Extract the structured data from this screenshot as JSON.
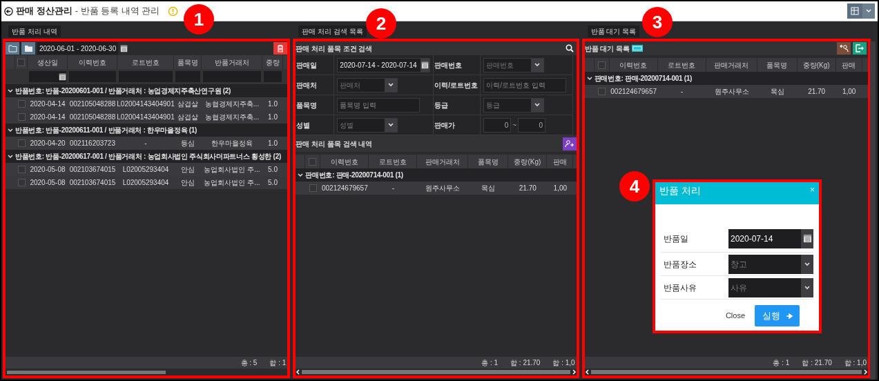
{
  "header": {
    "title": "판매 정산관리",
    "subtitle": "- 반품 등록 내역 관리"
  },
  "returns_panel": {
    "tab": "반품 처리 내역",
    "all_checked": false,
    "date_range": "2020-06-01 - 2020-06-30",
    "columns": [
      "생산일",
      "이력번호",
      "로트번호",
      "품목명",
      "반품거래처",
      "중량"
    ],
    "groups": [
      {
        "label": "반품번호: 반품-20200601-001 / 반품거래처 : 농업경제지주축산연구원 (2)",
        "expanded": true,
        "rows": [
          {
            "checked": false,
            "cells": [
              "2020-04-14",
              "002105048288",
              "L02004143404901",
              "삼겹살",
              "농협경제지주축...",
              "1.0"
            ]
          },
          {
            "checked": false,
            "cells": [
              "2020-04-14",
              "002105048288",
              "L02004143404901",
              "삼겹살",
              "농협경제지주축...",
              "1.0"
            ]
          }
        ]
      },
      {
        "label": "반품번호: 반품-20200611-001 / 반품거래처 : 한우마을정육 (1)",
        "expanded": true,
        "rows": [
          {
            "checked": false,
            "cells": [
              "2020-04-20",
              "002116203723",
              "-",
              "등심",
              "한우마을정육",
              "1.0"
            ]
          }
        ]
      },
      {
        "label": "반품번호: 반품-20200617-001 / 반품거래처 : 농업회사법인 주식회사더파트너스 횡성한 (2)",
        "expanded": true,
        "rows": [
          {
            "checked": false,
            "cells": [
              "2020-05-08",
              "002103674015",
              "L02005293404",
              "안심",
              "농업회사법인 주...",
              "5.0"
            ]
          },
          {
            "checked": false,
            "cells": [
              "2020-05-08",
              "002103674015",
              "L02005293404",
              "안심",
              "농업회사법인 주...",
              "5.0"
            ]
          }
        ]
      }
    ],
    "footer": [
      "총 : 5",
      "합 : 1"
    ]
  },
  "search_panel": {
    "tab": "판매 처리 검색 목록",
    "title": "판매 처리 품목 조건 검색",
    "fields": [
      {
        "label": "판매일",
        "kind": "date",
        "value": "2020-07-14 - 2020-07-14"
      },
      {
        "label": "판매번호",
        "kind": "select",
        "placeholder": "판매번호"
      },
      {
        "label": "판매처",
        "kind": "select",
        "placeholder": "판매처"
      },
      {
        "label": "이력/로트번호",
        "kind": "text",
        "placeholder": "이력/로트번호 입력"
      },
      {
        "label": "품목명",
        "kind": "text",
        "placeholder": "품목명 입력"
      },
      {
        "label": "등급",
        "kind": "select",
        "placeholder": "등급"
      },
      {
        "label": "성별",
        "kind": "select",
        "placeholder": "성별"
      },
      {
        "label": "판매가",
        "kind": "range",
        "from": "0",
        "separator": "~",
        "to": "0"
      }
    ],
    "results_title": "판매 처리 품목 검색 내역",
    "all_checked": false,
    "columns": [
      "이력번호",
      "로트번호",
      "판매거래처",
      "품목명",
      "중량(Kg)",
      "판매"
    ],
    "groups": [
      {
        "label": "판매번호: 판매-20200714-001 (1)",
        "expanded": true,
        "rows": [
          {
            "checked": false,
            "cells": [
              "002124679657",
              "-",
              "원주사무소",
              "목심",
              "21.70",
              "1,00"
            ]
          }
        ]
      }
    ],
    "footer": [
      "총 : 1",
      "합 : 21.70",
      "합 : 1,0"
    ]
  },
  "waiting_panel": {
    "tab": "반품 대기 목록",
    "title": "반품 대기 목록",
    "all_checked": false,
    "columns": [
      "이력번호",
      "로트번호",
      "판매거래처",
      "품목명",
      "중량(Kg)",
      "판매"
    ],
    "groups": [
      {
        "label": "판매번호: 판매-20200714-001 (1)",
        "expanded": true,
        "rows": [
          {
            "checked": false,
            "cells": [
              "002124679657",
              "-",
              "원주사무소",
              "목심",
              "21.70",
              "1,00"
            ]
          }
        ]
      }
    ],
    "footer": [
      "총 : 1",
      "합 : 21.70",
      "합 : 1,0"
    ]
  },
  "dialog": {
    "title": "반품 처리",
    "close_glyph": "×",
    "fields": [
      {
        "label": "반품일",
        "kind": "date",
        "value": "2020-07-14"
      },
      {
        "label": "반품장소",
        "kind": "select",
        "placeholder": "창고"
      },
      {
        "label": "반품사유",
        "kind": "select",
        "placeholder": "사유"
      }
    ],
    "buttons": [
      {
        "label": "Close",
        "kind": "plain"
      },
      {
        "label": "실행",
        "kind": "primary"
      }
    ]
  },
  "callouts": [
    "1",
    "2",
    "3",
    "4"
  ]
}
